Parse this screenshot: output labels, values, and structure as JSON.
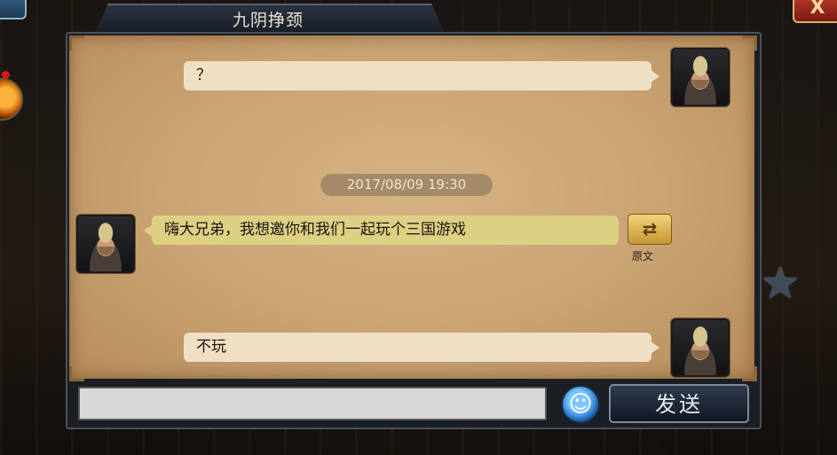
{
  "window": {
    "title": "九阴挣颈"
  },
  "messages": [
    {
      "side": "right",
      "text": "？"
    },
    {
      "side": "left",
      "text": "嗨大兄弟，我想邀你和我们一起玩个三国游戏"
    },
    {
      "side": "right",
      "text": "不玩"
    }
  ],
  "timestamp": "2017/08/09 19:30",
  "translate": {
    "label": "原文"
  },
  "input": {
    "value": "",
    "placeholder": ""
  },
  "controls": {
    "send_label": "发送",
    "close_label": "X"
  },
  "icons": {
    "close": "close-icon",
    "emoji": "smiley-icon",
    "translate": "swap-arrows-icon",
    "favorite": "star-icon"
  },
  "colors": {
    "parchment": "#c9a271",
    "bubble_self": "#efdfc3",
    "bubble_other": "#ddd083",
    "timestamp_bg": "#a48a68",
    "panel_dark": "#1b1e25"
  }
}
